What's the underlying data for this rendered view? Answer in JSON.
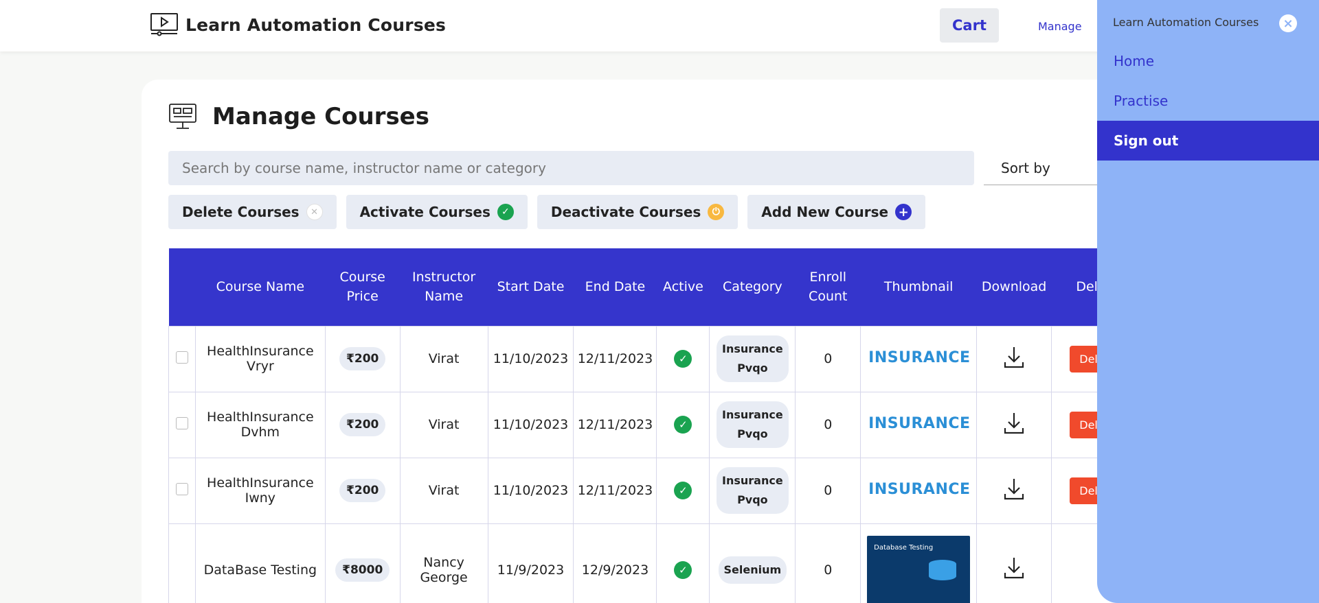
{
  "header": {
    "brand_title": "Learn Automation Courses",
    "cart_label": "Cart",
    "manage_label": "Manage"
  },
  "page": {
    "title": "Manage Courses",
    "search_placeholder": "Search by course name, instructor name or category",
    "sort_label": "Sort by"
  },
  "actions": {
    "delete_label": "Delete Courses",
    "activate_label": "Activate Courses",
    "deactivate_label": "Deactivate Courses",
    "add_label": "Add New Course"
  },
  "table": {
    "headers": {
      "course_name": "Course Name",
      "course_price_1": "Course",
      "course_price_2": "Price",
      "instructor_1": "Instructor",
      "instructor_2": "Name",
      "start_date": "Start Date",
      "end_date": "End Date",
      "active": "Active",
      "category": "Category",
      "enroll_1": "Enroll",
      "enroll_2": "Count",
      "thumbnail": "Thumbnail",
      "download": "Download",
      "delete": "Delete"
    },
    "rows": [
      {
        "name_1": "HealthInsurance",
        "name_2": "Vryr",
        "price": "₹200",
        "instructor": "Virat",
        "start": "11/10/2023",
        "end": "12/11/2023",
        "cat_1": "Insurance",
        "cat_2": "Pvqo",
        "enroll": "0",
        "thumb": "INSURANCE",
        "delete": "Delete"
      },
      {
        "name_1": "HealthInsurance",
        "name_2": "Dvhm",
        "price": "₹200",
        "instructor": "Virat",
        "start": "11/10/2023",
        "end": "12/11/2023",
        "cat_1": "Insurance",
        "cat_2": "Pvqo",
        "enroll": "0",
        "thumb": "INSURANCE",
        "delete": "Delete"
      },
      {
        "name_1": "HealthInsurance",
        "name_2": "Iwny",
        "price": "₹200",
        "instructor": "Virat",
        "start": "11/10/2023",
        "end": "12/11/2023",
        "cat_1": "Insurance",
        "cat_2": "Pvqo",
        "enroll": "0",
        "thumb": "INSURANCE",
        "delete": "Delete"
      },
      {
        "name": "DataBase Testing",
        "price": "₹8000",
        "instructor_1": "Nancy",
        "instructor_2": "George",
        "start": "11/9/2023",
        "end": "12/9/2023",
        "cat": "Selenium",
        "enroll": "0",
        "thumb": "Database Testing"
      }
    ]
  },
  "panel": {
    "title": "Learn Automation Courses",
    "close_icon": "×",
    "items": [
      "Home",
      "Practise",
      "Sign out"
    ]
  },
  "colors": {
    "accent": "#3333cc",
    "panel_bg": "#8eb3f7",
    "delete_red": "#f04a2c",
    "active_green": "#1aa350"
  }
}
